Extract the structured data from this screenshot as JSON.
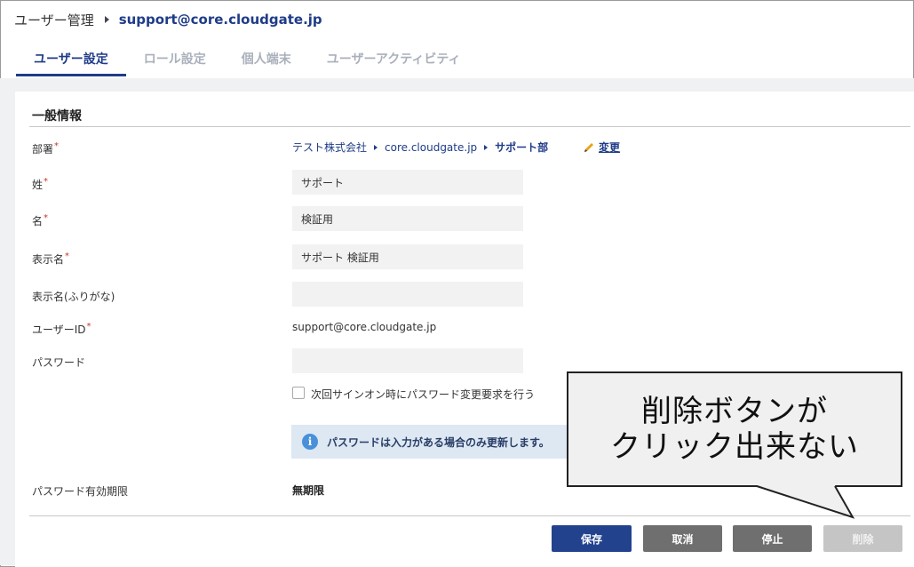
{
  "header": {
    "breadcrumb_root": "ユーザー管理",
    "breadcrumb_user": "support@core.cloudgate.jp"
  },
  "tabs": [
    {
      "label": "ユーザー設定",
      "active": true
    },
    {
      "label": "ロール設定",
      "active": false
    },
    {
      "label": "個人端末",
      "active": false
    },
    {
      "label": "ユーザーアクティビティ",
      "active": false
    }
  ],
  "section": {
    "title": "一般情報"
  },
  "form": {
    "department_label": "部署",
    "department_path": [
      "テスト株式会社",
      "core.cloudgate.jp",
      "サポート部"
    ],
    "change_label": "変更",
    "last_name_label": "姓",
    "last_name_value": "サポート",
    "first_name_label": "名",
    "first_name_value": "検証用",
    "display_name_label": "表示名",
    "display_name_value": "サポート 検証用",
    "display_kana_label": "表示名(ふりがな)",
    "display_kana_value": "",
    "user_id_label": "ユーザーID",
    "user_id_value": "support@core.cloudgate.jp",
    "password_label": "パスワード",
    "password_value": "",
    "password_change_checkbox_label": "次回サインオン時にパスワード変更要求を行う",
    "password_change_checked": false,
    "password_info": "パスワードは入力がある場合のみ更新します。",
    "password_expiry_label": "パスワード有効期限",
    "password_expiry_value": "無期限",
    "required_mark": "*"
  },
  "buttons": {
    "save": "保存",
    "cancel": "取消",
    "stop": "停止",
    "delete": "削除",
    "delete_disabled": true
  },
  "callout": {
    "line1": "削除ボタンが",
    "line2": "クリック出来ない"
  },
  "colors": {
    "accent": "#1f3c88",
    "save_button": "#23428e",
    "secondary_button": "#6f6f6f",
    "disabled_button": "#c5c5c5",
    "required": "#c0392b",
    "info_bg": "#dde8f3",
    "info_icon": "#4a90d9"
  },
  "icons": {
    "breadcrumb_separator": "triangle-right-icon",
    "edit": "pencil-icon",
    "info": "info-circle-icon"
  }
}
